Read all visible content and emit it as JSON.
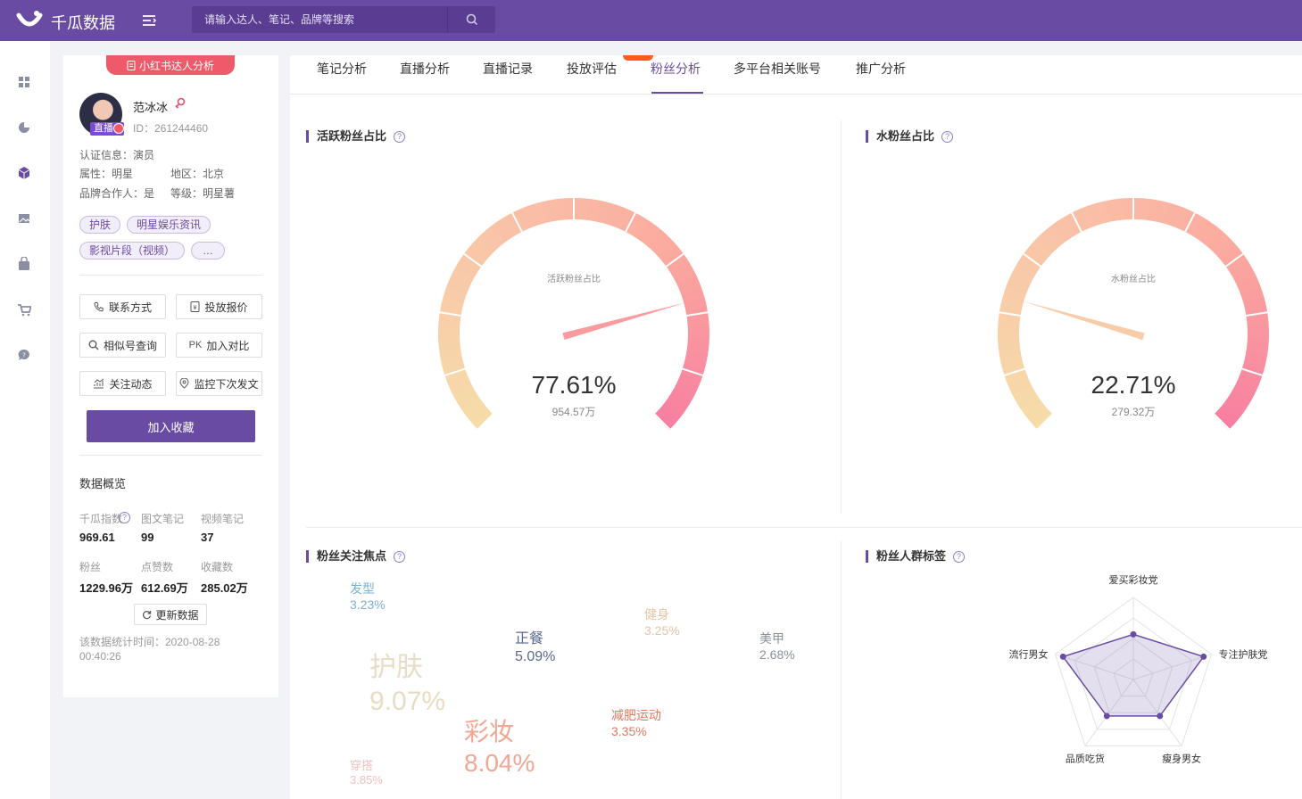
{
  "topbar": {
    "brand": "千瓜数据",
    "search_placeholder": "请输入达人、笔记、品牌等搜索"
  },
  "rail": {
    "icons": [
      "dashboard-icon",
      "pie-chart-icon",
      "cube-icon",
      "image-icon",
      "shopping-bag-icon",
      "cart-icon",
      "chat-icon"
    ]
  },
  "profile": {
    "badge": "小红书达人分析",
    "live_tag": "直播",
    "name": "范冰冰",
    "id": "ID：261244460",
    "cert": "认证信息：演员",
    "attr": "属性：明星",
    "region": "地区：北京",
    "brand_partner": "品牌合作人：是",
    "level": "等级：明星薯",
    "tags": [
      "护肤",
      "明星娱乐资讯",
      "影视片段（视频）",
      "…"
    ],
    "actions": {
      "contact": "联系方式",
      "quote": "投放报价",
      "similar": "相似号查询",
      "compare": "加入对比",
      "follow": "关注动态",
      "monitor": "监控下次发文"
    },
    "pk_label": "PK",
    "favorite": "加入收藏",
    "overview_title": "数据概览",
    "stats": [
      {
        "label": "千瓜指数",
        "value": "969.61"
      },
      {
        "label": "图文笔记",
        "value": "99"
      },
      {
        "label": "视频笔记",
        "value": "37"
      },
      {
        "label": "粉丝",
        "value": "1229.96万"
      },
      {
        "label": "点赞数",
        "value": "612.69万"
      },
      {
        "label": "收藏数",
        "value": "285.02万"
      }
    ],
    "refresh": "更新数据",
    "stat_time": "该数据统计时间：2020-08-28 00:40:26"
  },
  "tabs": [
    "笔记分析",
    "直播分析",
    "直播记录",
    "投放评估",
    "粉丝分析",
    "多平台相关账号",
    "推广分析"
  ],
  "active_tab": "粉丝分析",
  "cards": {
    "active_fans": {
      "title": "活跃粉丝占比",
      "gauge_label": "活跃粉丝占比",
      "percent_text": "77.61%",
      "sub": "954.57万",
      "value": 77.61
    },
    "water_fans": {
      "title": "水粉丝占比",
      "gauge_label": "水粉丝占比",
      "percent_text": "22.71%",
      "sub": "279.32万",
      "value": 22.71
    },
    "focus": {
      "title": "粉丝关注焦点",
      "words": [
        {
          "name": "发型",
          "pct": "3.23%",
          "color": "#7ab0d4"
        },
        {
          "name": "健身",
          "pct": "3.25%",
          "color": "#e8c4a4"
        },
        {
          "name": "正餐",
          "pct": "5.09%",
          "color": "#5a6a8c"
        },
        {
          "name": "美甲",
          "pct": "2.68%",
          "color": "#8a8f98"
        },
        {
          "name": "护肤",
          "pct": "9.07%",
          "color": "#e8dcc4"
        },
        {
          "name": "减肥运动",
          "pct": "3.35%",
          "color": "#e2795f"
        },
        {
          "name": "彩妆",
          "pct": "8.04%",
          "color": "#f0a795"
        },
        {
          "name": "穿搭",
          "pct": "3.85%",
          "color": "#f0bfbf"
        }
      ]
    },
    "crowd": {
      "title": "粉丝人群标签",
      "radar": {
        "labels": [
          "爱买彩妆党",
          "专注护肤党",
          "瘦身男女",
          "品质吃货",
          "流行男女"
        ],
        "values": [
          0.55,
          0.9,
          0.55,
          0.55,
          0.9
        ]
      }
    }
  },
  "colors": {
    "primary": "#6a4ba3",
    "gauge_pink": "#f77ea0",
    "gauge_yellow": "#f6dca9"
  }
}
